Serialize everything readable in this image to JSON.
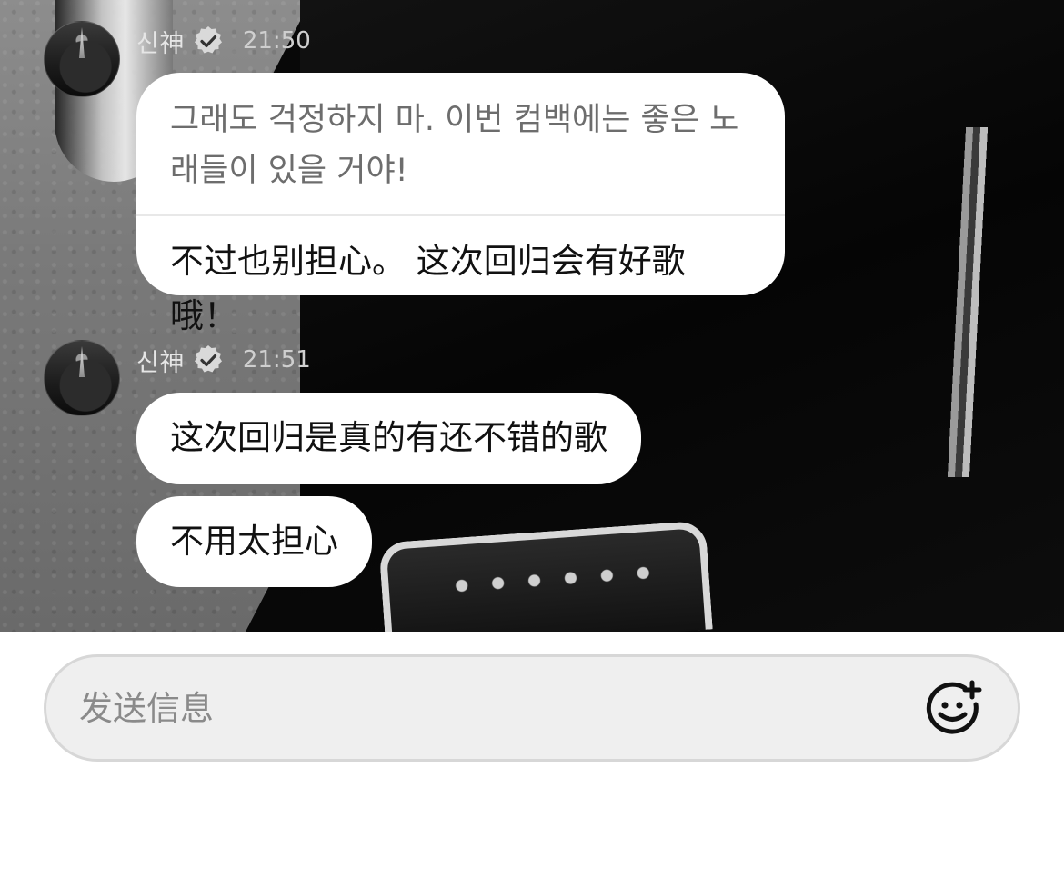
{
  "messages": [
    {
      "sender": "신神",
      "time": "21:50",
      "original_line1": "그래도 걱정하지 마. 이번 컴백에는 좋은 노",
      "original_line2": "래들이 있을 거야!",
      "translation": "不过也别担心。 这次回归会有好歌哦！"
    },
    {
      "sender": "신神",
      "time": "21:51",
      "texts": [
        "这次回归是真的有还不错的歌",
        "不用太担心"
      ]
    }
  ],
  "composer": {
    "placeholder": "发送信息",
    "emoji_icon": "add-emoji-icon"
  },
  "icons": {
    "verified": "verified-badge-icon"
  },
  "colors": {
    "bubble": "#ffffff",
    "input_bg": "#efefef",
    "placeholder": "#8a8a8a"
  }
}
